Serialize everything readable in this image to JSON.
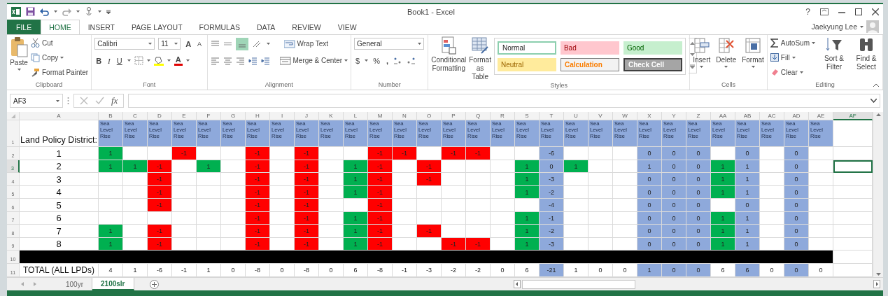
{
  "title_bar": {
    "title": "Book1 - Excel",
    "help": "?"
  },
  "tabs": [
    {
      "label": "FILE",
      "kind": "file",
      "selected": false
    },
    {
      "label": "HOME",
      "kind": "tab",
      "selected": true
    },
    {
      "label": "INSERT",
      "kind": "tab",
      "selected": false
    },
    {
      "label": "PAGE LAYOUT",
      "kind": "tab",
      "selected": false
    },
    {
      "label": "FORMULAS",
      "kind": "tab",
      "selected": false
    },
    {
      "label": "DATA",
      "kind": "tab",
      "selected": false
    },
    {
      "label": "REVIEW",
      "kind": "tab",
      "selected": false
    },
    {
      "label": "VIEW",
      "kind": "tab",
      "selected": false
    }
  ],
  "user": "Jaekyung Lee",
  "ribbon": {
    "groups": [
      {
        "kind": "clipboard",
        "label": "Clipboard",
        "paste": "Paste",
        "cut": "Cut",
        "copy": "Copy",
        "format_painter": "Format Painter"
      },
      {
        "kind": "font",
        "label": "Font",
        "font_name": "Calibri",
        "font_size": "11",
        "grow": "A",
        "shrink": "A",
        "bold": "B",
        "italic": "I",
        "underline": "U",
        "font_color": "A"
      },
      {
        "kind": "alignment",
        "label": "Alignment",
        "wrap_text": "Wrap Text",
        "merge_center": "Merge & Center"
      },
      {
        "kind": "number",
        "label": "Number",
        "format": "General",
        "currency": "$",
        "percent": "%",
        "comma": ","
      },
      {
        "kind": "styles",
        "label": "Styles",
        "conditional_formatting": "Conditional Formatting",
        "format_as_table": "Format as Table",
        "gallery": [
          {
            "name": "Normal",
            "kind": "normal"
          },
          {
            "name": "Bad",
            "kind": "bad"
          },
          {
            "name": "Good",
            "kind": "good"
          },
          {
            "name": "Neutral",
            "kind": "neutral"
          },
          {
            "name": "Calculation",
            "kind": "calculation"
          },
          {
            "name": "Check Cell",
            "kind": "check"
          }
        ]
      },
      {
        "kind": "cells",
        "label": "Cells",
        "buttons": [
          "Insert",
          "Delete",
          "Format"
        ]
      },
      {
        "kind": "editing",
        "label": "Editing",
        "autosum": "AutoSum",
        "fill": "Fill",
        "clear": "Clear",
        "sort_filter": "Sort & Filter",
        "find_select": "Find & Select"
      }
    ]
  },
  "formula_bar": {
    "name_box": "AF3",
    "fx": "fx"
  },
  "grid": {
    "columns": [
      {
        "letter": "A",
        "selected": false
      },
      {
        "letter": "B",
        "selected": false
      },
      {
        "letter": "C",
        "selected": false
      },
      {
        "letter": "D",
        "selected": false
      },
      {
        "letter": "E",
        "selected": false
      },
      {
        "letter": "F",
        "selected": false
      },
      {
        "letter": "G",
        "selected": false
      },
      {
        "letter": "H",
        "selected": false
      },
      {
        "letter": "I",
        "selected": false
      },
      {
        "letter": "J",
        "selected": false
      },
      {
        "letter": "K",
        "selected": false
      },
      {
        "letter": "L",
        "selected": false
      },
      {
        "letter": "M",
        "selected": false
      },
      {
        "letter": "N",
        "selected": false
      },
      {
        "letter": "O",
        "selected": false
      },
      {
        "letter": "P",
        "selected": false
      },
      {
        "letter": "Q",
        "selected": false
      },
      {
        "letter": "R",
        "selected": false
      },
      {
        "letter": "S",
        "selected": false
      },
      {
        "letter": "T",
        "selected": false
      },
      {
        "letter": "U",
        "selected": false
      },
      {
        "letter": "V",
        "selected": false
      },
      {
        "letter": "W",
        "selected": false
      },
      {
        "letter": "X",
        "selected": false
      },
      {
        "letter": "Y",
        "selected": false
      },
      {
        "letter": "Z",
        "selected": false
      },
      {
        "letter": "AA",
        "selected": false
      },
      {
        "letter": "AB",
        "selected": false
      },
      {
        "letter": "AC",
        "selected": false
      },
      {
        "letter": "AD",
        "selected": false
      },
      {
        "letter": "AE",
        "selected": false
      },
      {
        "letter": "AF",
        "selected": true
      }
    ],
    "header_row": {
      "number": "1",
      "selected": false,
      "cells": [
        "Land Policy District:",
        "Sea Level Rise",
        "Sea Level Rise",
        "Sea Level Rise",
        "Sea Level Rise",
        "Sea Level Rise",
        "Sea Level Rise",
        "Sea Level Rise",
        "Sea Level Rise",
        "Sea Level Rise",
        "Sea Level Rise",
        "Sea Level Rise",
        "Sea Level Rise",
        "Sea Level Rise",
        "Sea Level Rise",
        "Sea Level Rise",
        "Sea Level Rise",
        "Sea Level Rise",
        "Sea Level Rise",
        "Sea Level Rise",
        "Sea Level Rise",
        "Sea Level Rise",
        "Sea Level Rise",
        "Sea Level Rise",
        "Sea Level Rise",
        "Sea Level Rise",
        "Sea Level Rise",
        "Sea Level Rise",
        "Sea Level Rise",
        "Sea Level Rise",
        "Sea Level Rise"
      ]
    },
    "rows": [
      {
        "number": "2",
        "selected": false,
        "active": false,
        "cells": [
          "1",
          {
            "text": "1",
            "color": "#00b050"
          },
          "",
          "",
          {
            "text": "-1",
            "color": "#ff0000"
          },
          "",
          "",
          {
            "text": "-1",
            "color": "#ff0000"
          },
          "",
          {
            "text": "-1",
            "color": "#ff0000"
          },
          "",
          "",
          {
            "text": "-1",
            "color": "#ff0000"
          },
          {
            "text": "-1",
            "color": "#ff0000"
          },
          "",
          {
            "text": "-1",
            "color": "#ff0000"
          },
          {
            "text": "-1",
            "color": "#ff0000"
          },
          "",
          "",
          {
            "text": "-6",
            "color": "#8ea9db"
          },
          "",
          "",
          "",
          {
            "text": "0",
            "color": "#8ea9db"
          },
          {
            "text": "0",
            "color": "#8ea9db"
          },
          {
            "text": "0",
            "color": "#8ea9db"
          },
          "",
          {
            "text": "0",
            "color": "#8ea9db"
          },
          "",
          {
            "text": "0",
            "color": "#8ea9db"
          },
          ""
        ]
      },
      {
        "number": "3",
        "selected": true,
        "active": true,
        "cells": [
          "2",
          {
            "text": "1",
            "color": "#00b050"
          },
          {
            "text": "1",
            "color": "#00b050"
          },
          {
            "text": "-1",
            "color": "#ff0000"
          },
          "",
          {
            "text": "1",
            "color": "#00b050"
          },
          "",
          {
            "text": "-1",
            "color": "#ff0000"
          },
          "",
          {
            "text": "-1",
            "color": "#ff0000"
          },
          "",
          {
            "text": "1",
            "color": "#00b050"
          },
          {
            "text": "-1",
            "color": "#ff0000"
          },
          "",
          {
            "text": "-1",
            "color": "#ff0000"
          },
          "",
          "",
          "",
          {
            "text": "1",
            "color": "#00b050"
          },
          {
            "text": "0",
            "color": "#8ea9db"
          },
          {
            "text": "1",
            "color": "#00b050"
          },
          "",
          "",
          {
            "text": "1",
            "color": "#8ea9db"
          },
          {
            "text": "0",
            "color": "#8ea9db"
          },
          {
            "text": "0",
            "color": "#8ea9db"
          },
          {
            "text": "1",
            "color": "#00b050"
          },
          {
            "text": "1",
            "color": "#8ea9db"
          },
          "",
          {
            "text": "0",
            "color": "#8ea9db"
          },
          ""
        ]
      },
      {
        "number": "4",
        "selected": false,
        "active": false,
        "cells": [
          "3",
          "",
          "",
          {
            "text": "-1",
            "color": "#ff0000"
          },
          "",
          "",
          "",
          {
            "text": "-1",
            "color": "#ff0000"
          },
          "",
          {
            "text": "-1",
            "color": "#ff0000"
          },
          "",
          {
            "text": "1",
            "color": "#00b050"
          },
          {
            "text": "-1",
            "color": "#ff0000"
          },
          "",
          {
            "text": "-1",
            "color": "#ff0000"
          },
          "",
          "",
          "",
          {
            "text": "1",
            "color": "#00b050"
          },
          {
            "text": "-3",
            "color": "#8ea9db"
          },
          "",
          "",
          "",
          {
            "text": "0",
            "color": "#8ea9db"
          },
          {
            "text": "0",
            "color": "#8ea9db"
          },
          {
            "text": "0",
            "color": "#8ea9db"
          },
          {
            "text": "1",
            "color": "#00b050"
          },
          {
            "text": "1",
            "color": "#8ea9db"
          },
          "",
          {
            "text": "0",
            "color": "#8ea9db"
          },
          ""
        ]
      },
      {
        "number": "5",
        "selected": false,
        "active": false,
        "cells": [
          "4",
          "",
          "",
          {
            "text": "-1",
            "color": "#ff0000"
          },
          "",
          "",
          "",
          {
            "text": "-1",
            "color": "#ff0000"
          },
          "",
          {
            "text": "-1",
            "color": "#ff0000"
          },
          "",
          {
            "text": "1",
            "color": "#00b050"
          },
          {
            "text": "-1",
            "color": "#ff0000"
          },
          "",
          "",
          "",
          "",
          "",
          {
            "text": "1",
            "color": "#00b050"
          },
          {
            "text": "-2",
            "color": "#8ea9db"
          },
          "",
          "",
          "",
          {
            "text": "0",
            "color": "#8ea9db"
          },
          {
            "text": "0",
            "color": "#8ea9db"
          },
          {
            "text": "0",
            "color": "#8ea9db"
          },
          {
            "text": "1",
            "color": "#00b050"
          },
          {
            "text": "1",
            "color": "#8ea9db"
          },
          "",
          {
            "text": "0",
            "color": "#8ea9db"
          },
          ""
        ]
      },
      {
        "number": "6",
        "selected": false,
        "active": false,
        "cells": [
          "5",
          "",
          "",
          {
            "text": "-1",
            "color": "#ff0000"
          },
          "",
          "",
          "",
          {
            "text": "-1",
            "color": "#ff0000"
          },
          "",
          {
            "text": "-1",
            "color": "#ff0000"
          },
          "",
          "",
          {
            "text": "-1",
            "color": "#ff0000"
          },
          "",
          "",
          "",
          "",
          "",
          "",
          {
            "text": "-4",
            "color": "#8ea9db"
          },
          "",
          "",
          "",
          {
            "text": "0",
            "color": "#8ea9db"
          },
          {
            "text": "0",
            "color": "#8ea9db"
          },
          {
            "text": "0",
            "color": "#8ea9db"
          },
          "",
          {
            "text": "0",
            "color": "#8ea9db"
          },
          "",
          {
            "text": "0",
            "color": "#8ea9db"
          },
          ""
        ]
      },
      {
        "number": "7",
        "selected": false,
        "active": false,
        "cells": [
          "6",
          "",
          "",
          "",
          "",
          "",
          "",
          {
            "text": "-1",
            "color": "#ff0000"
          },
          "",
          {
            "text": "-1",
            "color": "#ff0000"
          },
          "",
          {
            "text": "1",
            "color": "#00b050"
          },
          {
            "text": "-1",
            "color": "#ff0000"
          },
          "",
          "",
          "",
          "",
          "",
          {
            "text": "1",
            "color": "#00b050"
          },
          {
            "text": "-1",
            "color": "#8ea9db"
          },
          "",
          "",
          "",
          {
            "text": "0",
            "color": "#8ea9db"
          },
          {
            "text": "0",
            "color": "#8ea9db"
          },
          {
            "text": "0",
            "color": "#8ea9db"
          },
          {
            "text": "1",
            "color": "#00b050"
          },
          {
            "text": "1",
            "color": "#8ea9db"
          },
          "",
          {
            "text": "0",
            "color": "#8ea9db"
          },
          ""
        ]
      },
      {
        "number": "8",
        "selected": false,
        "active": false,
        "cells": [
          "7",
          {
            "text": "1",
            "color": "#00b050"
          },
          "",
          {
            "text": "-1",
            "color": "#ff0000"
          },
          "",
          "",
          "",
          {
            "text": "-1",
            "color": "#ff0000"
          },
          "",
          {
            "text": "-1",
            "color": "#ff0000"
          },
          "",
          {
            "text": "1",
            "color": "#00b050"
          },
          {
            "text": "-1",
            "color": "#ff0000"
          },
          "",
          {
            "text": "-1",
            "color": "#ff0000"
          },
          "",
          "",
          "",
          {
            "text": "1",
            "color": "#00b050"
          },
          {
            "text": "-2",
            "color": "#8ea9db"
          },
          "",
          "",
          "",
          {
            "text": "0",
            "color": "#8ea9db"
          },
          {
            "text": "0",
            "color": "#8ea9db"
          },
          {
            "text": "0",
            "color": "#8ea9db"
          },
          {
            "text": "1",
            "color": "#00b050"
          },
          {
            "text": "1",
            "color": "#8ea9db"
          },
          "",
          {
            "text": "0",
            "color": "#8ea9db"
          },
          ""
        ]
      },
      {
        "number": "9",
        "selected": false,
        "active": false,
        "cells": [
          "8",
          {
            "text": "1",
            "color": "#00b050"
          },
          "",
          {
            "text": "-1",
            "color": "#ff0000"
          },
          "",
          "",
          "",
          {
            "text": "-1",
            "color": "#ff0000"
          },
          "",
          {
            "text": "-1",
            "color": "#ff0000"
          },
          "",
          {
            "text": "1",
            "color": "#00b050"
          },
          {
            "text": "-1",
            "color": "#ff0000"
          },
          "",
          "",
          {
            "text": "-1",
            "color": "#ff0000"
          },
          {
            "text": "-1",
            "color": "#ff0000"
          },
          "",
          {
            "text": "1",
            "color": "#00b050"
          },
          {
            "text": "-3",
            "color": "#8ea9db"
          },
          "",
          "",
          "",
          {
            "text": "0",
            "color": "#8ea9db"
          },
          {
            "text": "0",
            "color": "#8ea9db"
          },
          {
            "text": "0",
            "color": "#8ea9db"
          },
          {
            "text": "1",
            "color": "#00b050"
          },
          {
            "text": "1",
            "color": "#8ea9db"
          },
          "",
          {
            "text": "0",
            "color": "#8ea9db"
          },
          ""
        ]
      }
    ],
    "divider_row": {
      "number": "10",
      "selected": false
    },
    "total_row": {
      "number": "11",
      "selected": false,
      "cells": [
        "TOTAL (ALL LPDs)",
        "4",
        "1",
        "-6",
        "-1",
        "1",
        "0",
        "-8",
        "0",
        "-8",
        "0",
        "6",
        "-8",
        "-1",
        "-3",
        "-2",
        "-2",
        "0",
        "6",
        {
          "text": "-21",
          "color": "#8ea9db"
        },
        "1",
        "0",
        "0",
        {
          "text": "1",
          "color": "#8ea9db"
        },
        {
          "text": "0",
          "color": "#8ea9db"
        },
        {
          "text": "0",
          "color": "#8ea9db"
        },
        "6",
        {
          "text": "6",
          "color": "#8ea9db"
        },
        "0",
        {
          "text": "0",
          "color": "#8ea9db"
        },
        "0"
      ]
    }
  },
  "sheet_tabs": [
    {
      "label": "100yr",
      "selected": false
    },
    {
      "label": "2100slr",
      "selected": true
    }
  ]
}
